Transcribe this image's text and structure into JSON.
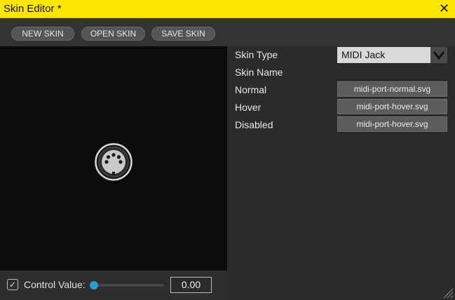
{
  "window": {
    "title": "Skin Editor *",
    "close_glyph": "✕",
    "accent_color": "#ffe600"
  },
  "toolbar": {
    "new_skin": "NEW SKIN",
    "open_skin": "OPEN SKIN",
    "save_skin": "SAVE SKIN"
  },
  "preview": {
    "icon": "midi-jack-icon"
  },
  "control": {
    "checked": true,
    "check_glyph": "✓",
    "label": "Control Value:",
    "value_text": "0.00",
    "slider_value": 0.0,
    "slider_color": "#2e9bd0"
  },
  "properties": {
    "skin_type_label": "Skin Type",
    "skin_type_value": "MIDI Jack",
    "skin_name_label": "Skin Name",
    "skin_name_value": "",
    "normal_label": "Normal",
    "normal_file": "midi-port-normal.svg",
    "hover_label": "Hover",
    "hover_file": "midi-port-hover.svg",
    "disabled_label": "Disabled",
    "disabled_file": "midi-port-hover.svg"
  }
}
